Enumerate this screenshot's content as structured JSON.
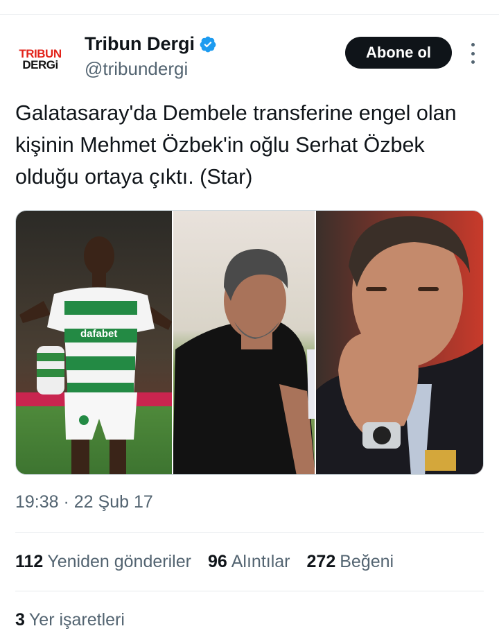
{
  "account": {
    "logo_line1": "TRIBUN",
    "logo_line2": "DERGi",
    "display_name": "Tribun Dergi",
    "handle": "@tribundergi",
    "verified": true
  },
  "actions": {
    "follow_label": "Abone ol"
  },
  "tweet": {
    "text": "Galatasaray'da Dembele transferine engel olan kişinin Mehmet Özbek'in oğlu Serhat Özbek olduğu ortaya çıktı. (Star)",
    "media_shirt_text": "dafabet",
    "timestamp": "19:38 · 22 Şub 17"
  },
  "stats": {
    "reposts_count": "112",
    "reposts_label": "Yeniden gönderiler",
    "quotes_count": "96",
    "quotes_label": "Alıntılar",
    "likes_count": "272",
    "likes_label": "Beğeni",
    "bookmarks_count": "3",
    "bookmarks_label": "Yer işaretleri"
  },
  "colors": {
    "verified_blue": "#1d9bf0",
    "button_bg": "#0f1419",
    "logo_red": "#e2231a",
    "secondary_text": "#536471"
  }
}
